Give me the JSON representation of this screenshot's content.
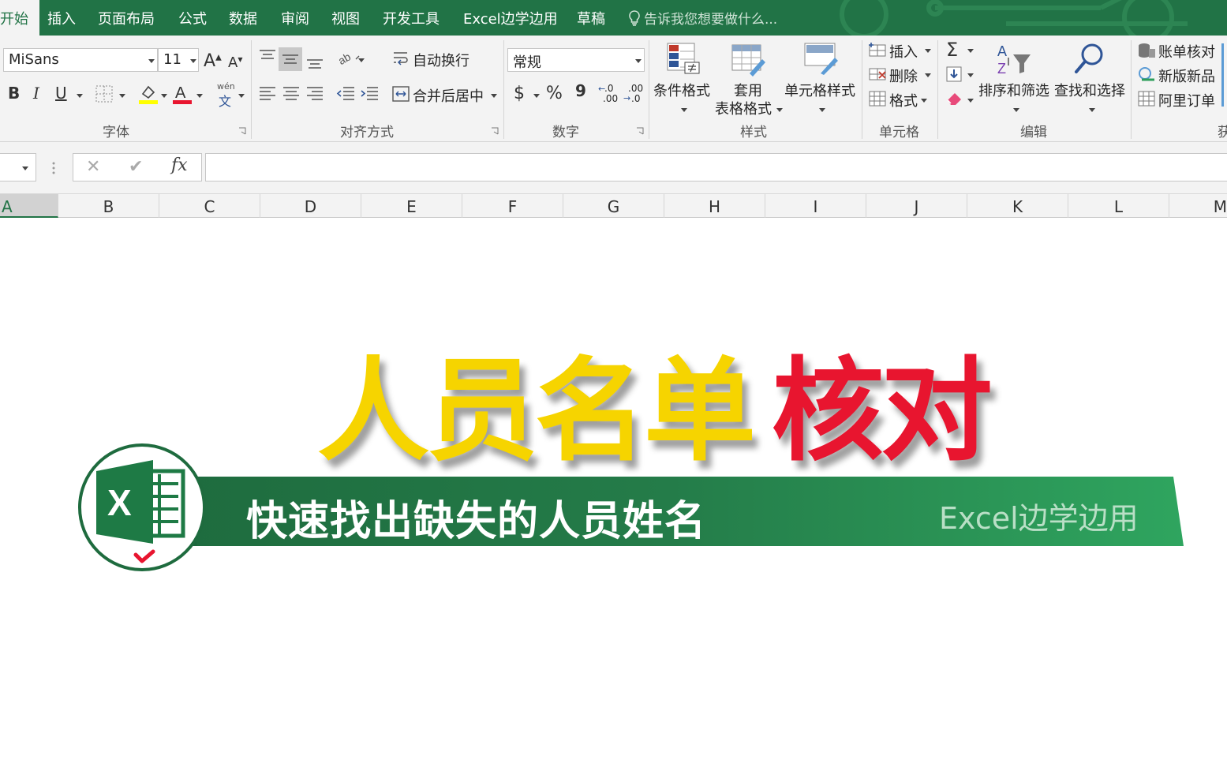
{
  "tabs": {
    "home": "开始",
    "insert": "插入",
    "page_layout": "页面布局",
    "formulas": "公式",
    "data": "数据",
    "review": "审阅",
    "view": "视图",
    "developer": "开发工具",
    "addin": "Excel边学边用",
    "draft": "草稿",
    "tell_me": "告诉我您想要做什么..."
  },
  "font_group": {
    "label": "字体",
    "font_name": "MiSans",
    "font_size": "11",
    "bold": "B",
    "italic": "I",
    "underline": "U",
    "grow": "A",
    "shrink": "A",
    "pinyin_top": "wén",
    "pinyin_bottom": "文",
    "fill_color": "#ffff00",
    "font_color": "#e8152f"
  },
  "align_group": {
    "label": "对齐方式",
    "wrap_text": "自动换行",
    "merge_center": "合并后居中"
  },
  "number_group": {
    "label": "数字",
    "format": "常规",
    "currency": "$",
    "percent": "%",
    "comma": "9",
    "inc_decimal_top": ".0",
    "inc_decimal_bottom": ".00",
    "dec_decimal_top": ".00",
    "dec_decimal_bottom": ".0"
  },
  "styles_group": {
    "label": "样式",
    "conditional": "条件格式",
    "table_format_1": "套用",
    "table_format_2": "表格格式",
    "cell_styles": "单元格样式"
  },
  "cells_group": {
    "label": "单元格",
    "insert": "插入",
    "delete": "删除",
    "format": "格式"
  },
  "editing_group": {
    "label": "编辑",
    "sigma": "Σ",
    "sort_filter": "排序和筛选",
    "find_select": "查找和选择"
  },
  "extra_group": {
    "reconcile": "账单核对",
    "new_product": "新版新品",
    "ali_order": "阿里订单",
    "label_partial": "获"
  },
  "formula_bar": {
    "cancel": "✕",
    "enter": "✔",
    "fx": "fx",
    "value": ""
  },
  "columns": [
    "A",
    "B",
    "C",
    "D",
    "E",
    "F",
    "G",
    "H",
    "I",
    "J",
    "K",
    "L",
    "M"
  ],
  "overlay": {
    "title_part1": "人员名单",
    "title_part2": "核对",
    "subtitle": "快速找出缺失的人员姓名",
    "brand": "Excel边学边用",
    "logo_letter": "X"
  },
  "colors": {
    "excel_green": "#217346",
    "title_yellow": "#f6d400",
    "title_red": "#e8152f",
    "banner_green": "#2a9a5a"
  }
}
